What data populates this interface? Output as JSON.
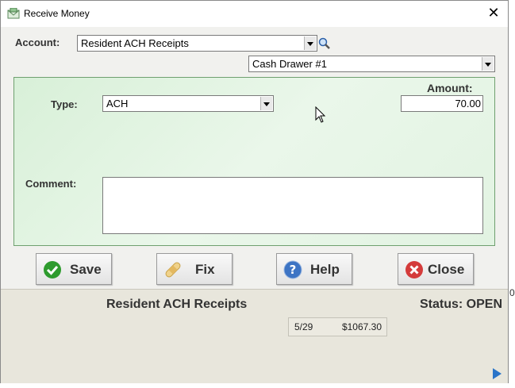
{
  "window": {
    "title": "Receive Money",
    "close_glyph": "✕"
  },
  "form": {
    "account_label": "Account:",
    "account_value": "Resident ACH Receipts",
    "drawer_value": "Cash Drawer #1",
    "type_label": "Type:",
    "type_value": "ACH",
    "amount_label": "Amount:",
    "amount_value": "70.00",
    "comment_label": "Comment:",
    "comment_value": ""
  },
  "buttons": {
    "save": {
      "label": "Save",
      "icon": "check-icon",
      "color": "#2e9b2e"
    },
    "fix": {
      "label": "Fix",
      "icon": "bandage-icon",
      "color": "#e8c470"
    },
    "help": {
      "label": "Help",
      "icon": "question-icon",
      "color": "#3d74c4"
    },
    "close": {
      "label": "Close",
      "icon": "x-circle-icon",
      "color": "#d43b3b"
    }
  },
  "summary": {
    "account_name": "Resident ACH Receipts",
    "status": "Status: OPEN",
    "entries": [
      {
        "date": "5/29",
        "amount": "$1067.30"
      }
    ],
    "edge_text": "0"
  },
  "colors": {
    "panel_green": "#d8f0d8",
    "panel_border": "#6fa06f",
    "bottom_bg": "#e8e6dc",
    "accent_blue": "#2a74c8"
  }
}
